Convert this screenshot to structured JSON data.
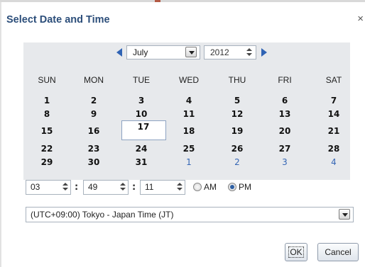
{
  "dialog": {
    "title": "Select Date and Time",
    "close_glyph": "×"
  },
  "calendar": {
    "month": "July",
    "year": "2012",
    "weekdays": [
      "SUN",
      "MON",
      "TUE",
      "WED",
      "THU",
      "FRI",
      "SAT"
    ],
    "weeks": [
      [
        "1",
        "2",
        "3",
        "4",
        "5",
        "6",
        "7"
      ],
      [
        "8",
        "9",
        "10",
        "11",
        "12",
        "13",
        "14"
      ],
      [
        "15",
        "16",
        "17",
        "18",
        "19",
        "20",
        "21"
      ],
      [
        "22",
        "23",
        "24",
        "25",
        "26",
        "27",
        "28"
      ],
      [
        "29",
        "30",
        "31",
        "1",
        "2",
        "3",
        "4"
      ]
    ],
    "selected_day": "17"
  },
  "time": {
    "hour": "03",
    "minute": "49",
    "second": "11",
    "separator": ":",
    "am_label": "AM",
    "pm_label": "PM",
    "period_selected": "PM"
  },
  "timezone": {
    "value": "(UTC+09:00) Tokyo - Japan Time (JT)"
  },
  "buttons": {
    "ok": "OK",
    "cancel": "Cancel"
  },
  "colors": {
    "title": "#2c4e7a",
    "accent": "#2f63b4",
    "calendar_bg": "#e7e9ec"
  }
}
